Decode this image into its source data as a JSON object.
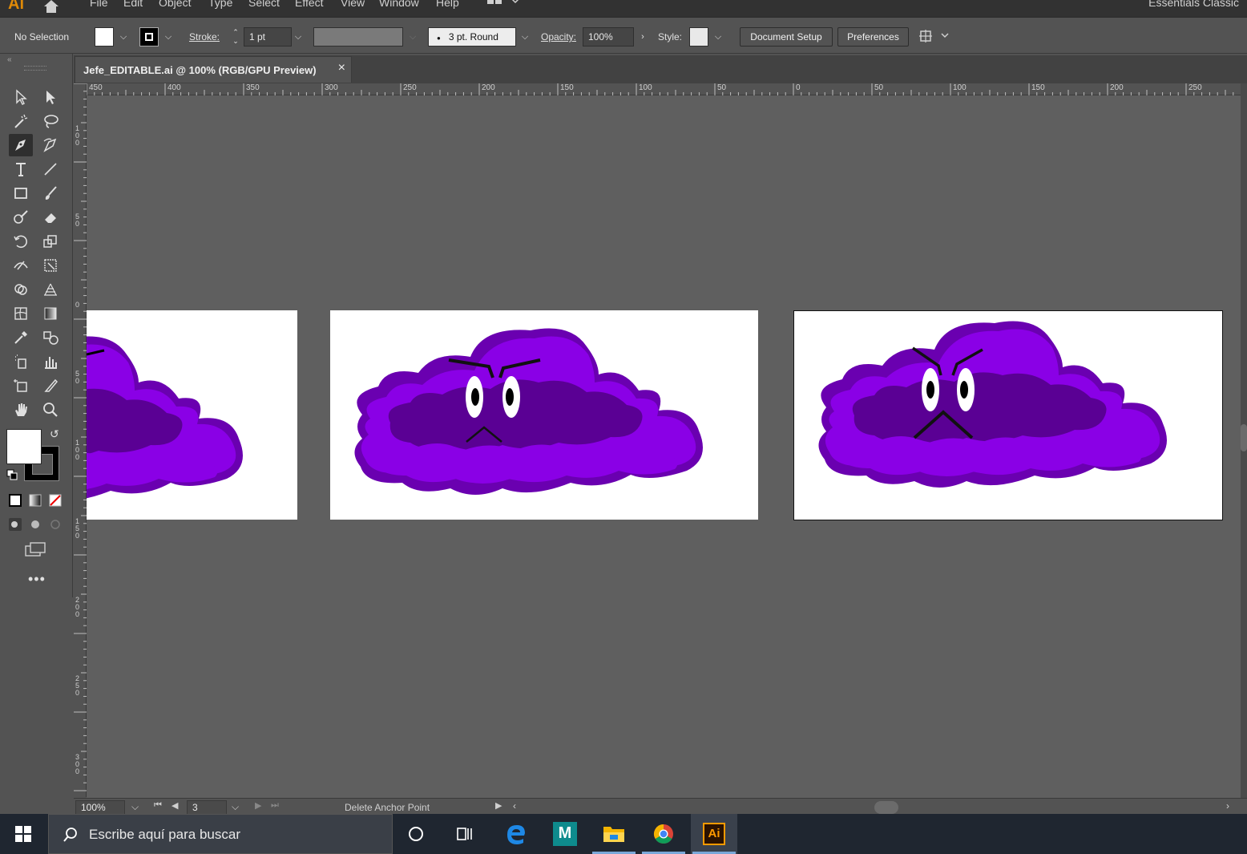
{
  "menubar": {
    "app_logo": "Ai",
    "items": [
      "File",
      "Edit",
      "Object",
      "Type",
      "Select",
      "Effect",
      "View",
      "Window",
      "Help"
    ],
    "workspace": "Essentials Classic"
  },
  "controlbar": {
    "selection_state": "No Selection",
    "stroke_label": "Stroke:",
    "stroke_weight": "1 pt",
    "brush_profile": "3 pt. Round",
    "opacity_label": "Opacity:",
    "opacity_value": "100%",
    "style_label": "Style:",
    "document_setup": "Document Setup",
    "preferences": "Preferences"
  },
  "document": {
    "tab_title": "Jefe_EDITABLE.ai @ 100% (RGB/GPU Preview)",
    "close_glyph": "×"
  },
  "rulers": {
    "horizontal": [
      "450",
      "400",
      "350",
      "300",
      "250",
      "200",
      "150",
      "100",
      "50",
      "0",
      "50",
      "100",
      "150",
      "200",
      "250"
    ],
    "vertical": [
      "100",
      "50",
      "0",
      "50",
      "100",
      "150",
      "200",
      "250",
      "300"
    ]
  },
  "statusbar": {
    "zoom": "100%",
    "artboard_number": "3",
    "current_tool": "Delete Anchor Point"
  },
  "taskbar": {
    "search_placeholder": "Escribe aquí para buscar",
    "apps": [
      "cortana-icon",
      "task-view-icon",
      "edge-icon",
      "maya-icon",
      "file-explorer-icon",
      "chrome-icon",
      "illustrator-icon"
    ],
    "maya_label": "M",
    "illustrator_label": "Ai"
  },
  "colors": {
    "cloud_light": "#8a00e6",
    "cloud_mid": "#7200c4",
    "cloud_dark": "#5a0094",
    "canvas": "#5f5f5f",
    "ui": "#535353",
    "illustrator_orange": "#ff9a00"
  }
}
